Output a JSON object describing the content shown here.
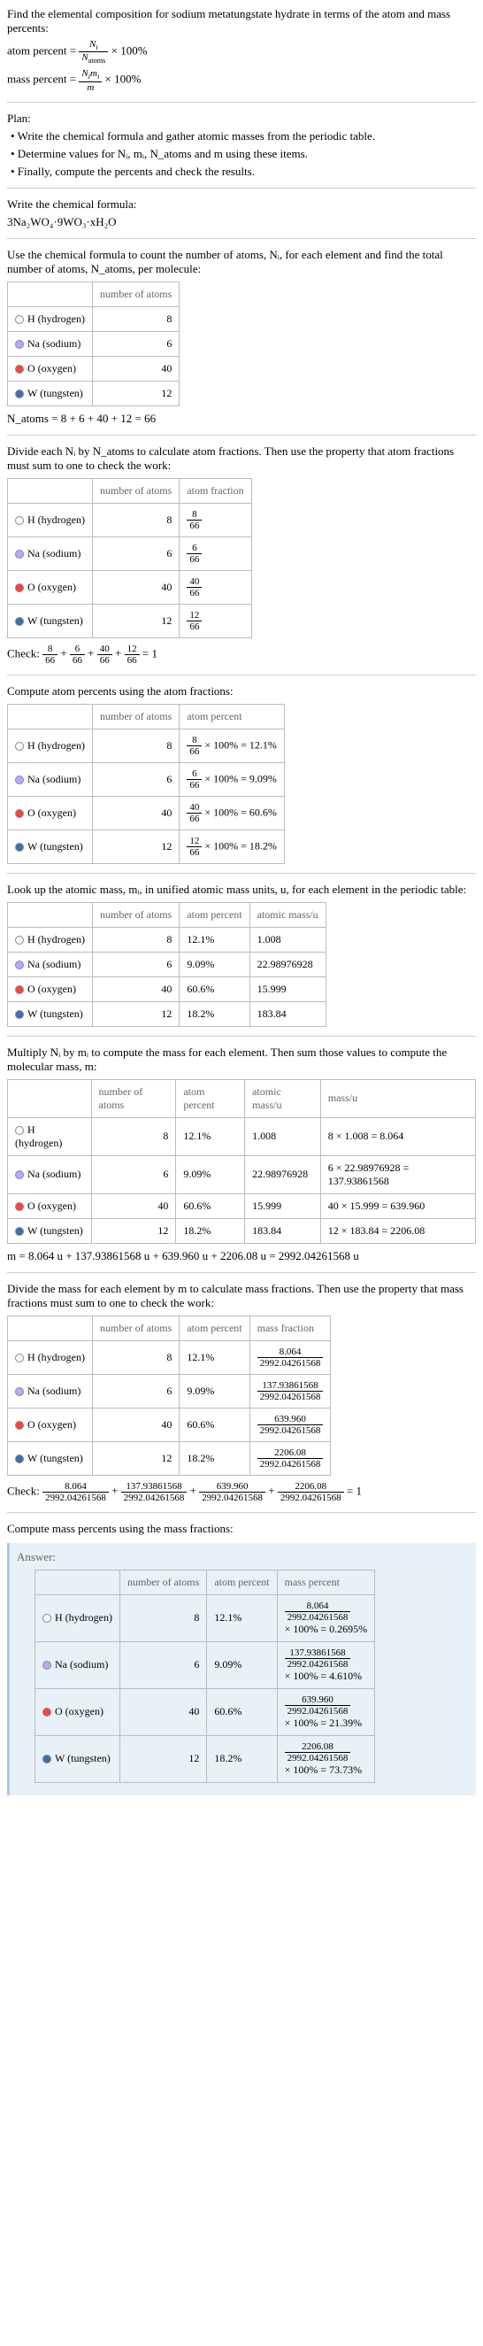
{
  "intro": {
    "p1": "Find the elemental composition for sodium metatungstate hydrate in terms of the atom and mass percents:",
    "eq1_l": "atom percent = ",
    "eq1_n": "N",
    "eq1_n_sub": "i",
    "eq1_d": "N",
    "eq1_d_sub": "atoms",
    "eq1_r": " × 100%",
    "eq2_l": "mass percent = ",
    "eq2_n": "N",
    "eq2_n2": "m",
    "eq2_n_sub": "i",
    "eq2_n2_sub": "i",
    "eq2_d": "m",
    "eq2_r": " × 100%"
  },
  "plan": {
    "h": "Plan:",
    "b1": "• Write the chemical formula and gather atomic masses from the periodic table.",
    "b2": "• Determine values for Nᵢ, mᵢ, N_atoms and m using these items.",
    "b3": "• Finally, compute the percents and check the results."
  },
  "formula": {
    "p1": "Write the chemical formula:",
    "f": "3Na₂WO₄·9WO₃·xH₂O"
  },
  "count": {
    "p1": "Use the chemical formula to count the number of atoms, Nᵢ, for each element and find the total number of atoms, N_atoms, per molecule:",
    "h1": "",
    "h2": "number of atoms",
    "rows": [
      {
        "c": "#f5faff",
        "n": "H (hydrogen)",
        "v": "8"
      },
      {
        "c": "#bfa3ff",
        "n": "Na (sodium)",
        "v": "6"
      },
      {
        "c": "#ff4040",
        "n": "O (oxygen)",
        "v": "40"
      },
      {
        "c": "#3a6fb0",
        "n": "W (tungsten)",
        "v": "12"
      }
    ],
    "sum": "N_atoms = 8 + 6 + 40 + 12 = 66"
  },
  "atomfrac": {
    "p1": "Divide each Nᵢ by N_atoms to calculate atom fractions. Then use the property that atom fractions must sum to one to check the work:",
    "h1": "",
    "h2": "number of atoms",
    "h3": "atom fraction",
    "rows": [
      {
        "c": "#f5faff",
        "n": "H (hydrogen)",
        "v": "8",
        "fn": "8",
        "fd": "66"
      },
      {
        "c": "#bfa3ff",
        "n": "Na (sodium)",
        "v": "6",
        "fn": "6",
        "fd": "66"
      },
      {
        "c": "#ff4040",
        "n": "O (oxygen)",
        "v": "40",
        "fn": "40",
        "fd": "66"
      },
      {
        "c": "#3a6fb0",
        "n": "W (tungsten)",
        "v": "12",
        "fn": "12",
        "fd": "66"
      }
    ],
    "check_l": "Check: ",
    "check_r": " = 1"
  },
  "atompct": {
    "p1": "Compute atom percents using the atom fractions:",
    "h1": "",
    "h2": "number of atoms",
    "h3": "atom percent",
    "rows": [
      {
        "c": "#f5faff",
        "n": "H (hydrogen)",
        "v": "8",
        "fn": "8",
        "fd": "66",
        "p": " × 100% = 12.1%"
      },
      {
        "c": "#bfa3ff",
        "n": "Na (sodium)",
        "v": "6",
        "fn": "6",
        "fd": "66",
        "p": " × 100% = 9.09%"
      },
      {
        "c": "#ff4040",
        "n": "O (oxygen)",
        "v": "40",
        "fn": "40",
        "fd": "66",
        "p": " × 100% = 60.6%"
      },
      {
        "c": "#3a6fb0",
        "n": "W (tungsten)",
        "v": "12",
        "fn": "12",
        "fd": "66",
        "p": " × 100% = 18.2%"
      }
    ]
  },
  "massu": {
    "p1": "Look up the atomic mass, mᵢ, in unified atomic mass units, u, for each element in the periodic table:",
    "h1": "",
    "h2": "number of atoms",
    "h3": "atom percent",
    "h4": "atomic mass/u",
    "rows": [
      {
        "c": "#f5faff",
        "n": "H (hydrogen)",
        "v": "8",
        "p": "12.1%",
        "m": "1.008"
      },
      {
        "c": "#bfa3ff",
        "n": "Na (sodium)",
        "v": "6",
        "p": "9.09%",
        "m": "22.98976928"
      },
      {
        "c": "#ff4040",
        "n": "O (oxygen)",
        "v": "40",
        "p": "60.6%",
        "m": "15.999"
      },
      {
        "c": "#3a6fb0",
        "n": "W (tungsten)",
        "v": "12",
        "p": "18.2%",
        "m": "183.84"
      }
    ]
  },
  "massmul": {
    "p1": "Multiply Nᵢ by mᵢ to compute the mass for each element. Then sum those values to compute the molecular mass, m:",
    "h1": "",
    "h2": "number of atoms",
    "h3": "atom percent",
    "h4": "atomic mass/u",
    "h5": "mass/u",
    "rows": [
      {
        "c": "#f5faff",
        "n": "H (hydrogen)",
        "v": "8",
        "p": "12.1%",
        "m": "1.008",
        "mm": "8 × 1.008 = 8.064"
      },
      {
        "c": "#bfa3ff",
        "n": "Na (sodium)",
        "v": "6",
        "p": "9.09%",
        "m": "22.98976928",
        "mm": "6 × 22.98976928 = 137.93861568"
      },
      {
        "c": "#ff4040",
        "n": "O (oxygen)",
        "v": "40",
        "p": "60.6%",
        "m": "15.999",
        "mm": "40 × 15.999 = 639.960"
      },
      {
        "c": "#3a6fb0",
        "n": "W (tungsten)",
        "v": "12",
        "p": "18.2%",
        "m": "183.84",
        "mm": "12 × 183.84 = 2206.08"
      }
    ],
    "sum": "m = 8.064 u + 137.93861568 u + 639.960 u + 2206.08 u = 2992.04261568 u"
  },
  "massfrac": {
    "p1": "Divide the mass for each element by m to calculate mass fractions. Then use the property that mass fractions must sum to one to check the work:",
    "h1": "",
    "h2": "number of atoms",
    "h3": "atom percent",
    "h4": "mass fraction",
    "rows": [
      {
        "c": "#f5faff",
        "n": "H (hydrogen)",
        "v": "8",
        "p": "12.1%",
        "fn": "8.064",
        "fd": "2992.04261568"
      },
      {
        "c": "#bfa3ff",
        "n": "Na (sodium)",
        "v": "6",
        "p": "9.09%",
        "fn": "137.93861568",
        "fd": "2992.04261568"
      },
      {
        "c": "#ff4040",
        "n": "O (oxygen)",
        "v": "40",
        "p": "60.6%",
        "fn": "639.960",
        "fd": "2992.04261568"
      },
      {
        "c": "#3a6fb0",
        "n": "W (tungsten)",
        "v": "12",
        "p": "18.2%",
        "fn": "2206.08",
        "fd": "2992.04261568"
      }
    ],
    "check_l": "Check: ",
    "check_r": " = 1"
  },
  "masspct": {
    "p1": "Compute mass percents using the mass fractions:"
  },
  "answer": {
    "h": "Answer:",
    "h1": "",
    "h2": "number of atoms",
    "h3": "atom percent",
    "h4": "mass percent",
    "rows": [
      {
        "c": "#f5faff",
        "n": "H (hydrogen)",
        "v": "8",
        "p": "12.1%",
        "fn": "8.064",
        "fd": "2992.04261568",
        "r": "× 100% = 0.2695%"
      },
      {
        "c": "#bfa3ff",
        "n": "Na (sodium)",
        "v": "6",
        "p": "9.09%",
        "fn": "137.93861568",
        "fd": "2992.04261568",
        "r": "× 100% = 4.610%"
      },
      {
        "c": "#ff4040",
        "n": "O (oxygen)",
        "v": "40",
        "p": "60.6%",
        "fn": "639.960",
        "fd": "2992.04261568",
        "r": "× 100% = 21.39%"
      },
      {
        "c": "#3a6fb0",
        "n": "W (tungsten)",
        "v": "12",
        "p": "18.2%",
        "fn": "2206.08",
        "fd": "2992.04261568",
        "r": "× 100% = 73.73%"
      }
    ]
  }
}
